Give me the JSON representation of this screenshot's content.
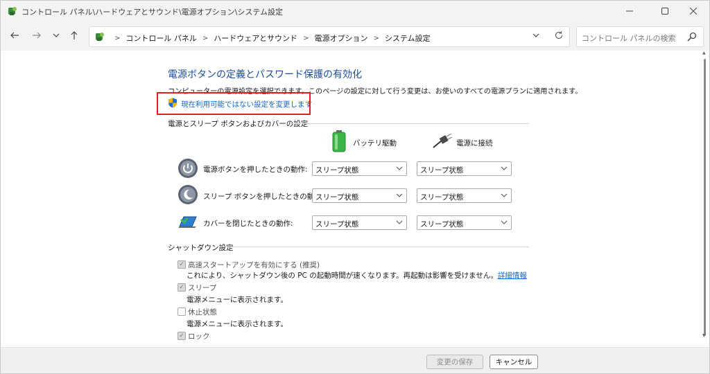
{
  "window": {
    "title": "コントロール パネル\\ハードウェアとサウンド\\電源オプション\\システム設定",
    "icon": "control-panel-icon"
  },
  "nav": {
    "back_icon": "arrow-left-icon",
    "forward_icon": "arrow-right-icon",
    "recent_icon": "chevron-down-icon",
    "up_icon": "arrow-up-icon",
    "breadcrumbs": [
      "コントロール パネル",
      "ハードウェアとサウンド",
      "電源オプション",
      "システム設定"
    ],
    "search_placeholder": "コントロール パネルの検索"
  },
  "page": {
    "title": "電源ボタンの定義とパスワード保護の有効化",
    "description": "コンピューターの電源設定を選択できます。このページの設定に対して行う変更は、お使いのすべての電源プランに適用されます。",
    "change_link": "現在利用可能ではない設定を変更します"
  },
  "power_section": {
    "title": "電源とスリープ ボタンおよびカバーの設定",
    "col_battery": "バッテリ駆動",
    "col_plugged": "電源に接続",
    "rows": [
      {
        "label": "電源ボタンを押したときの動作:",
        "battery": "スリープ状態",
        "plugged": "スリープ状態"
      },
      {
        "label": "スリープ ボタンを押したときの動作:",
        "battery": "スリープ状態",
        "plugged": "スリープ状態"
      },
      {
        "label": "カバーを閉じたときの動作:",
        "battery": "スリープ状態",
        "plugged": "スリープ状態"
      }
    ]
  },
  "shutdown_section": {
    "title": "シャットダウン設定",
    "items": [
      {
        "label": "高速スタートアップを有効にする (推奨)",
        "checked": true,
        "desc": "これにより、シャットダウン後の PC の起動時間が速くなります。再起動は影響を受けません。",
        "link": "詳細情報"
      },
      {
        "label": "スリープ",
        "checked": true,
        "desc": "電源メニューに表示されます。"
      },
      {
        "label": "休止状態",
        "checked": false,
        "desc": "電源メニューに表示されます。"
      },
      {
        "label": "ロック",
        "checked": true
      }
    ]
  },
  "footer": {
    "save": "変更の保存",
    "cancel": "キャンセル"
  },
  "colors": {
    "accent": "#1766c2",
    "title": "#1b4d96",
    "highlight": "#e02020"
  }
}
